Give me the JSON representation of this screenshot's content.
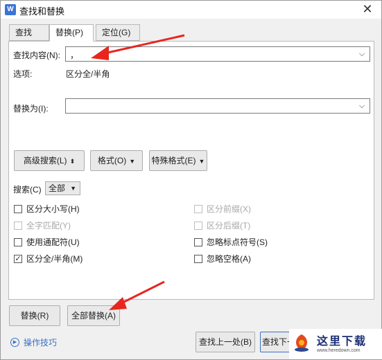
{
  "window": {
    "title": "查找和替换",
    "icon_letter": "W"
  },
  "tabs": [
    {
      "label": "查找(D)",
      "active": false
    },
    {
      "label": "替换(P)",
      "active": true
    },
    {
      "label": "定位(G)",
      "active": false
    }
  ],
  "find": {
    "label": "查找内容(N):",
    "value": "，"
  },
  "options": {
    "label": "选项:",
    "value": "区分全/半角"
  },
  "replace": {
    "label": "替换为(I):",
    "value": ""
  },
  "buttons": {
    "advanced": "高级搜索(L)",
    "format": "格式(O)",
    "special": "特殊格式(E)",
    "replace": "替换(R)",
    "replace_all": "全部替换(A)",
    "find_prev": "查找上一处(B)",
    "find_next": "查找下一处"
  },
  "search": {
    "label": "搜索(C)",
    "value": "全部"
  },
  "checkboxes_left": [
    {
      "label": "区分大小写(H)",
      "checked": false,
      "disabled": false
    },
    {
      "label": "全字匹配(Y)",
      "checked": false,
      "disabled": true
    },
    {
      "label": "使用通配符(U)",
      "checked": false,
      "disabled": false
    },
    {
      "label": "区分全/半角(M)",
      "checked": true,
      "disabled": false
    }
  ],
  "checkboxes_right": [
    {
      "label": "区分前缀(X)",
      "checked": false,
      "disabled": true
    },
    {
      "label": "区分后缀(T)",
      "checked": false,
      "disabled": true
    },
    {
      "label": "忽略标点符号(S)",
      "checked": false,
      "disabled": false
    },
    {
      "label": "忽略空格(A)",
      "checked": false,
      "disabled": false
    }
  ],
  "help": {
    "label": "操作技巧"
  },
  "watermark": {
    "text": "这里下载",
    "url": "www.heredown.com"
  },
  "colors": {
    "annotation_arrow": "#e8261f",
    "link": "#3a6fc4"
  }
}
